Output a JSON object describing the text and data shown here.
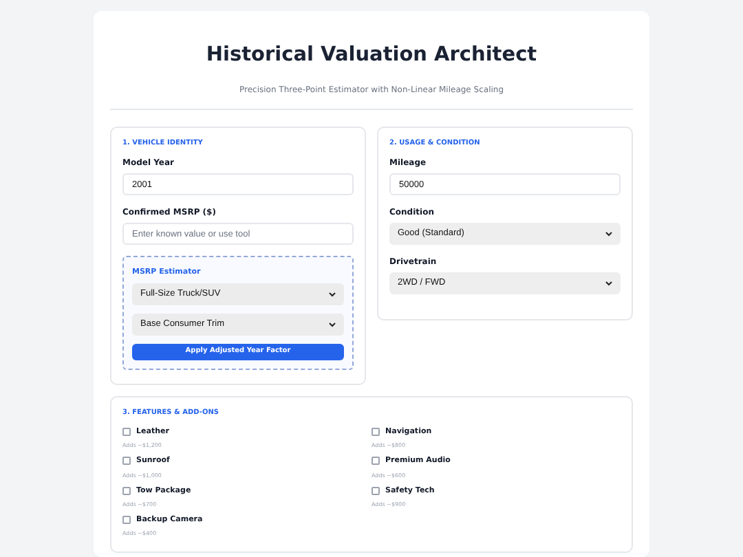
{
  "header": {
    "title": "Historical Valuation Architect",
    "subtitle": "Precision Three-Point Estimator with Non-Linear Mileage Scaling"
  },
  "vehicle_identity": {
    "heading": "1. VEHICLE IDENTITY",
    "fields": [
      {
        "label": "Model Year",
        "value": "2001"
      },
      {
        "label": "Confirmed MSRP ($)",
        "placeholder": "Enter known value or use tool"
      }
    ],
    "estimator": {
      "heading": "MSRP Estimator",
      "selects": [
        "Full-Size Truck/SUV",
        "Base Consumer Trim"
      ],
      "button": "Apply Adjusted Year Factor"
    }
  },
  "usage_condition": {
    "heading": "2. USAGE & CONDITION",
    "fields": [
      {
        "label": "Mileage",
        "kind": "input",
        "value": "50000"
      },
      {
        "label": "Condition",
        "kind": "select",
        "value": "Good (Standard)"
      },
      {
        "label": "Drivetrain",
        "kind": "select",
        "value": "2WD / FWD"
      }
    ]
  },
  "features": {
    "heading": "3. FEATURES & ADD-ONS",
    "items": [
      {
        "label": "Leather",
        "note": "Adds ~$1,200",
        "checked": false
      },
      {
        "label": "Navigation",
        "note": "Adds ~$800",
        "checked": false
      },
      {
        "label": "Sunroof",
        "note": "Adds ~$1,000",
        "checked": false
      },
      {
        "label": "Premium Audio",
        "note": "Adds ~$600",
        "checked": false
      },
      {
        "label": "Tow Package",
        "note": "Adds ~$700",
        "checked": false
      },
      {
        "label": "Safety Tech",
        "note": "Adds ~$900",
        "checked": false
      },
      {
        "label": "Backup Camera",
        "note": "Adds ~$400",
        "checked": false
      }
    ]
  }
}
